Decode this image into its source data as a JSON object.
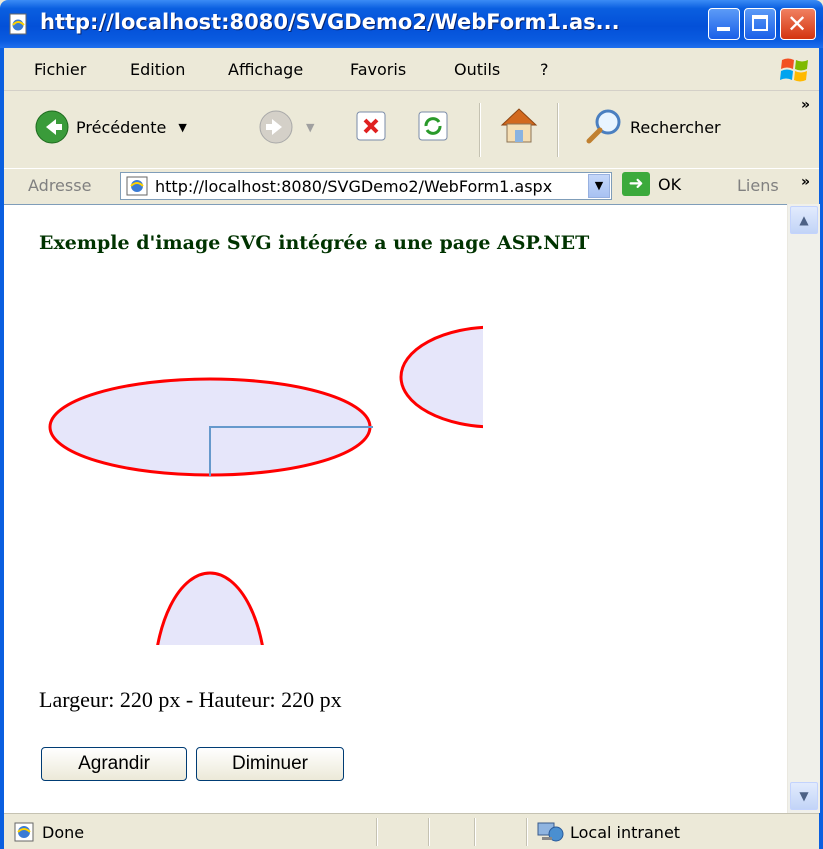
{
  "window": {
    "title": "http://localhost:8080/SVGDemo2/WebForm1.as..."
  },
  "menu": {
    "items": [
      {
        "label": "Fichier"
      },
      {
        "label": "Edition"
      },
      {
        "label": "Affichage"
      },
      {
        "label": "Favoris"
      },
      {
        "label": "Outils"
      },
      {
        "label": "?"
      }
    ]
  },
  "toolbar": {
    "back_label": "Précédente",
    "search_label": "Rechercher"
  },
  "address": {
    "label": "Adresse",
    "url": "http://localhost:8080/SVGDemo2/WebForm1.aspx",
    "go_label": "OK",
    "links_label": "Liens"
  },
  "page": {
    "heading": "Exemple d'image SVG intégrée a une page ASP.NET",
    "dimensions_text": "Largeur: 220 px - Hauteur: 220 px",
    "grow_button": "Agrandir",
    "shrink_button": "Diminuer"
  },
  "status": {
    "text": "Done",
    "zone": "Local intranet"
  },
  "colors": {
    "ellipse_fill": "#e6e6fa",
    "ellipse_stroke": "#ff0000",
    "line_stroke": "#6699cc",
    "heading_color": "#003300"
  }
}
